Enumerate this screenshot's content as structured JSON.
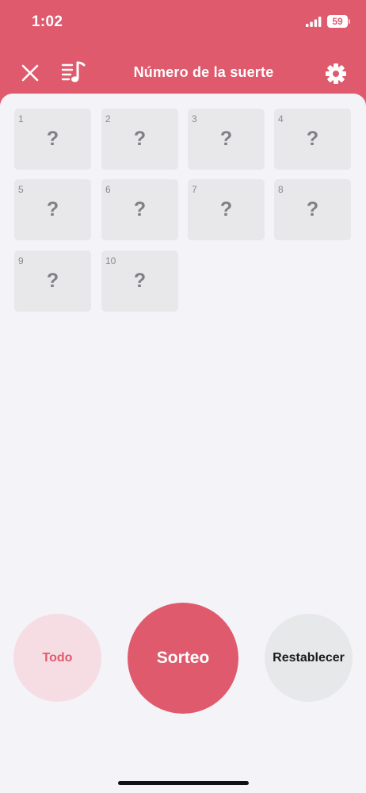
{
  "status_bar": {
    "time": "1:02",
    "battery_level": "59",
    "icons": [
      "cellular-signal-icon",
      "battery-icon"
    ]
  },
  "nav": {
    "title": "Número de la suerte",
    "icons": {
      "close": "close-icon",
      "playlist": "music-playlist-icon",
      "settings": "gear-icon"
    }
  },
  "tiles": [
    {
      "number": "1",
      "value": "?"
    },
    {
      "number": "2",
      "value": "?"
    },
    {
      "number": "3",
      "value": "?"
    },
    {
      "number": "4",
      "value": "?"
    },
    {
      "number": "5",
      "value": "?"
    },
    {
      "number": "6",
      "value": "?"
    },
    {
      "number": "7",
      "value": "?"
    },
    {
      "number": "8",
      "value": "?"
    },
    {
      "number": "9",
      "value": "?"
    },
    {
      "number": "10",
      "value": "?"
    }
  ],
  "actions": {
    "all_label": "Todo",
    "draw_label": "Sorteo",
    "reset_label": "Restablecer"
  },
  "colors": {
    "accent": "#df5a6d",
    "accent_light": "#f5dde3",
    "background": "#f4f3f7",
    "tile": "#e8e8ea",
    "neutral_button": "#e7e8ea"
  }
}
